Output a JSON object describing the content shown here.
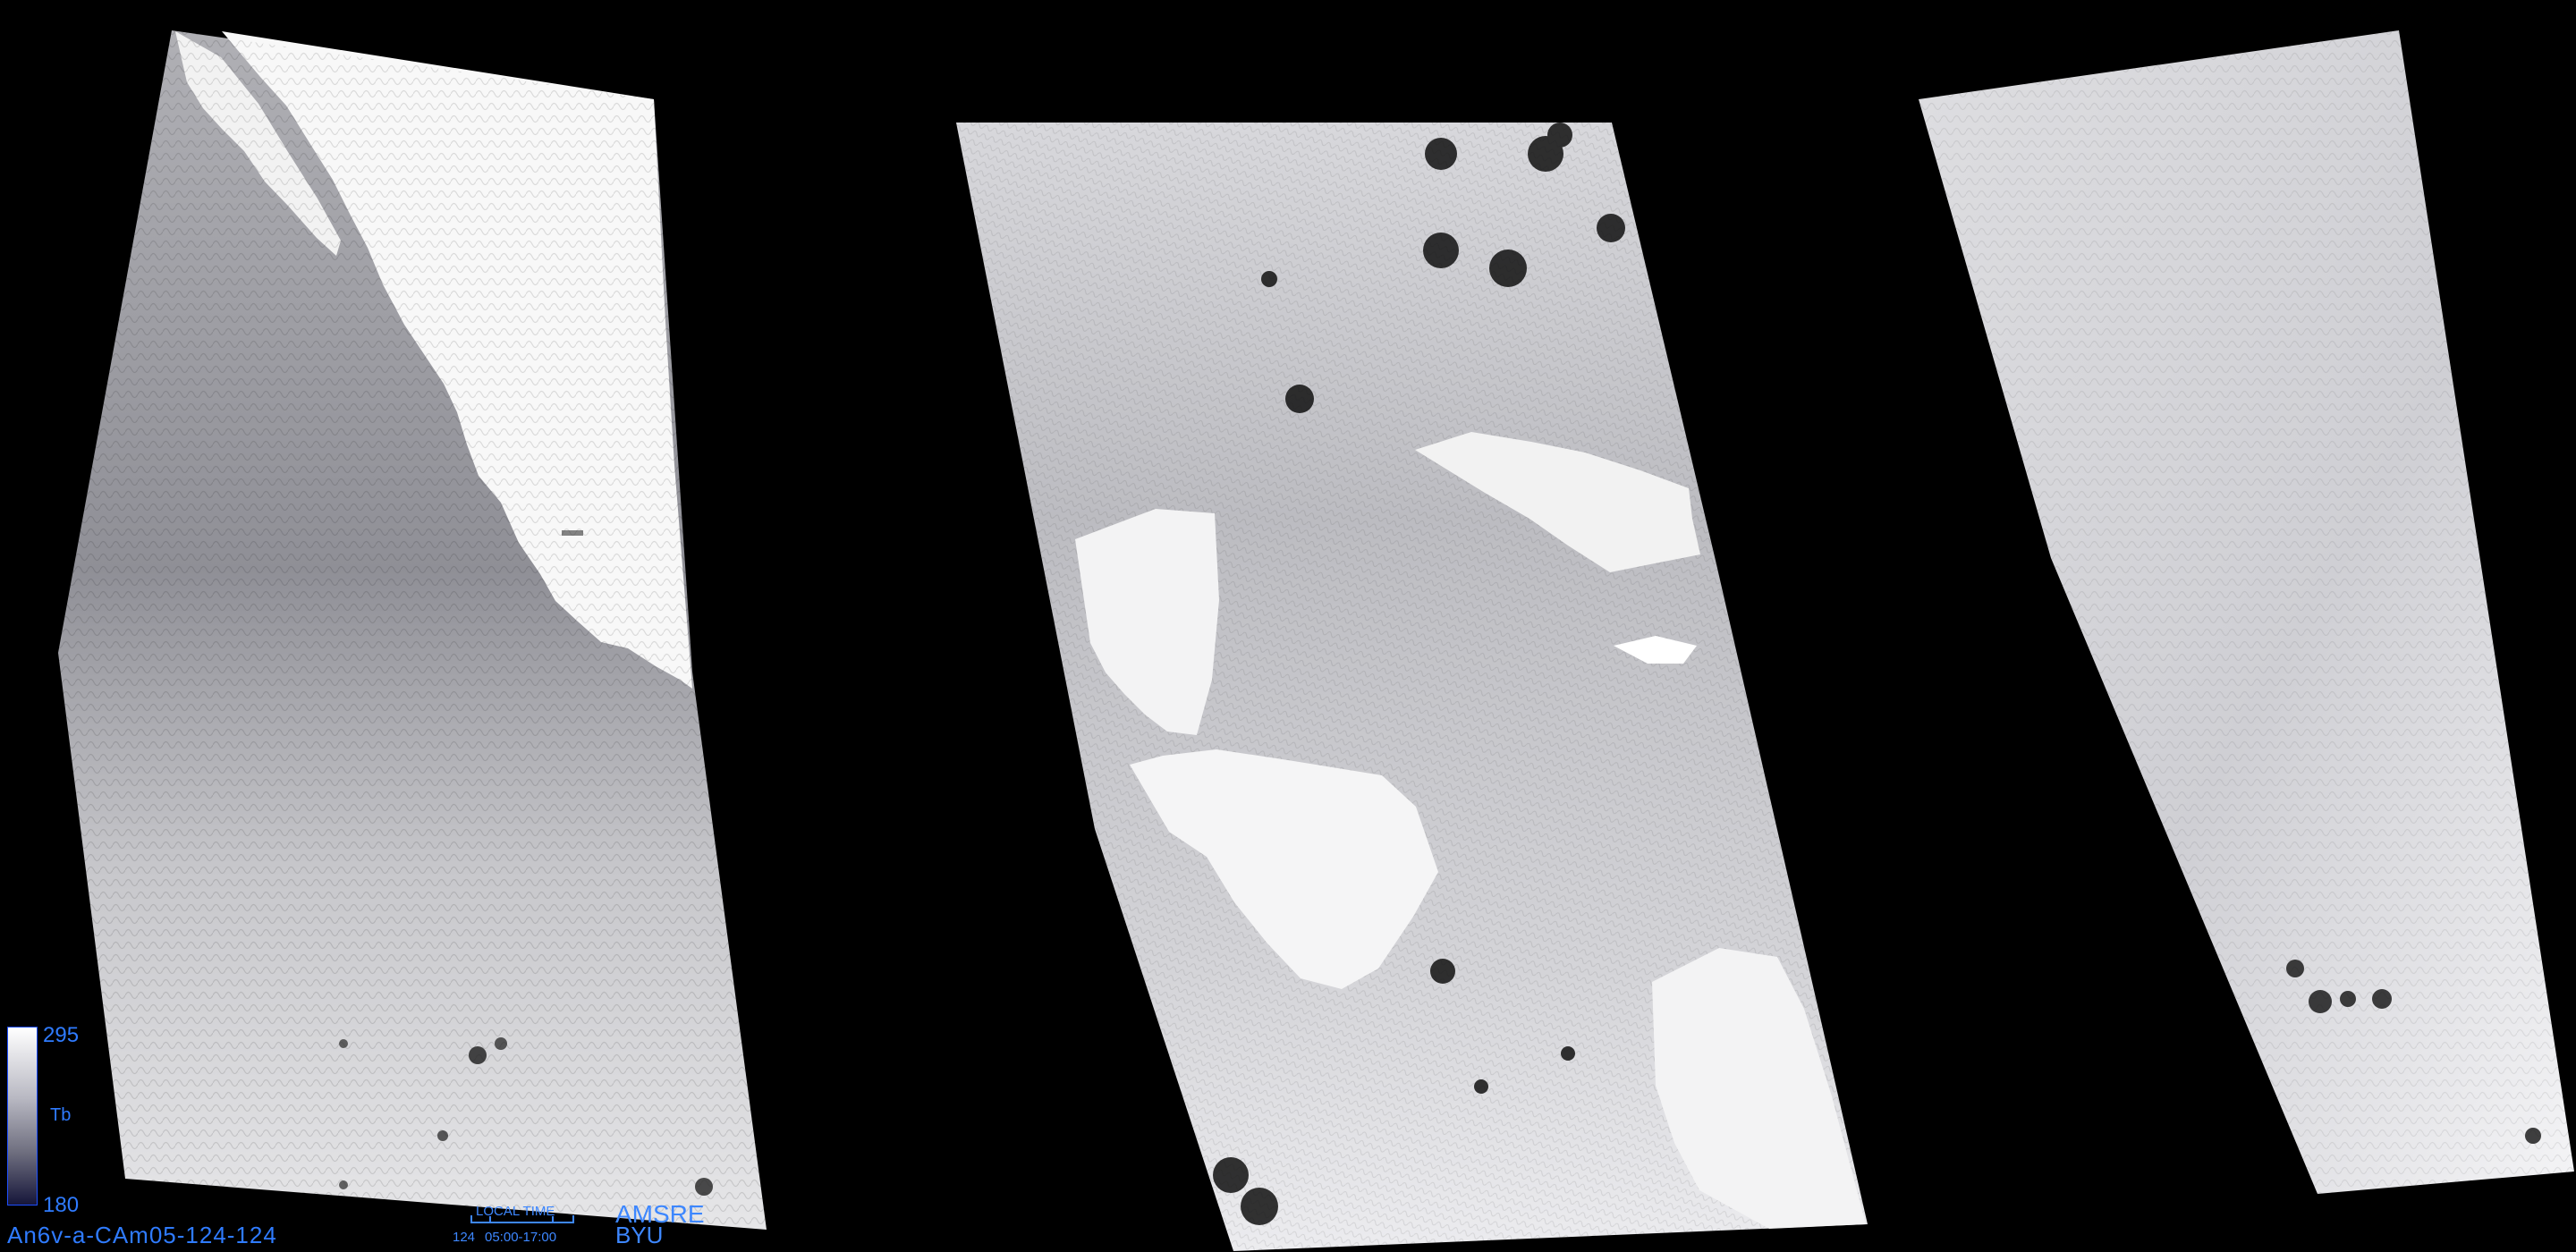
{
  "image": {
    "background_color": "#000000",
    "swath_colors": {
      "land": "#f7f7f7",
      "ocean_light": "#cfcfd4",
      "ocean_dark": "#8f8f96",
      "storm": "#101010"
    }
  },
  "colorbar": {
    "max_label": "295",
    "mid_label": "Tb",
    "min_label": "180",
    "top_color": "#ffffff",
    "bottom_color": "#16163a",
    "frame_color": "#1d4fff"
  },
  "caption": {
    "filename": "An6v-a-CAm05-124-124",
    "local_time_label": "LOCAL TIME",
    "day": "124",
    "time_range": "05:00-17:00",
    "sensor": "AMSRE",
    "organization": "BYU",
    "text_color": "#2f7bff"
  }
}
